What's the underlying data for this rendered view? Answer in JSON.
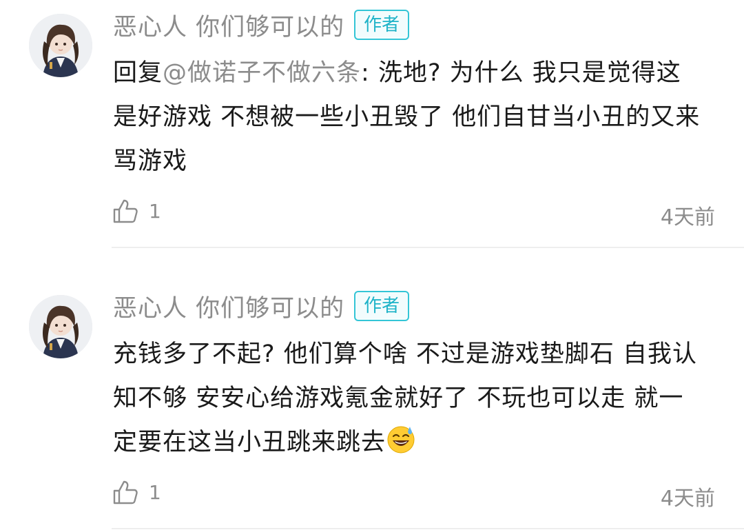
{
  "comments": [
    {
      "author": "恶心人 你们够可以的",
      "badge": "作者",
      "reply_prefix": "回复",
      "reply_target": "@做诺子不做六条",
      "text": ": 洗地? 为什么 我只是觉得这是好游戏 不想被一些小丑毁了 他们自甘当小丑的又来骂游戏",
      "likes": "1",
      "time": "4天前"
    },
    {
      "author": "恶心人 你们够可以的",
      "badge": "作者",
      "text": "充钱多了不起? 他们算个啥 不过是游戏垫脚石 自我认知不够 安安心给游戏氪金就好了 不玩也可以走 就一定要在这当小丑跳来跳去",
      "emoji": "sweat-smile-emoji",
      "likes": "1",
      "time": "4天前"
    }
  ],
  "colors": {
    "badge_border": "#33c5d6",
    "badge_text": "#1fb3c8",
    "secondary_text": "#8c8c8c",
    "primary_text": "#1a1a1a",
    "divider": "#eeeeee"
  },
  "icons": {
    "like": "thumbs-up-icon",
    "avatar": "anime-character-avatar"
  }
}
